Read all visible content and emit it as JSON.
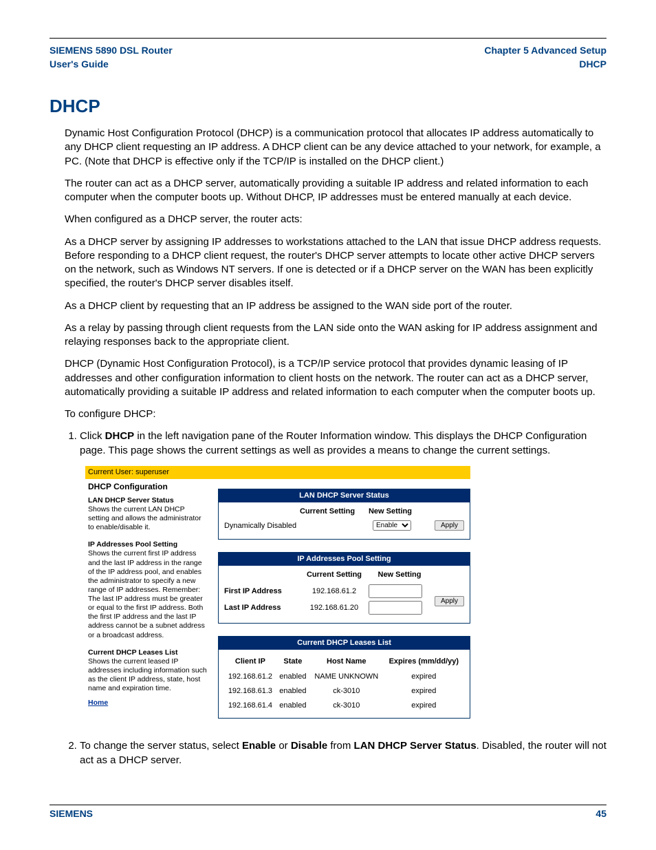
{
  "header": {
    "left_line1": "SIEMENS 5890 DSL Router",
    "left_line2": "User's Guide",
    "right_line1": "Chapter 5  Advanced Setup",
    "right_line2": "DHCP"
  },
  "title": "DHCP",
  "paragraphs": {
    "p1": "Dynamic Host Configuration Protocol (DHCP) is a communication protocol that allocates IP address automatically to any DHCP client requesting an IP address. A DHCP client can be any device attached to your network, for example, a PC. (Note that DHCP is effective only if the TCP/IP is installed on the DHCP client.)",
    "p2": "The router can act as a DHCP server, automatically providing a suitable IP address and related information to each computer when the computer boots up. Without DHCP, IP addresses must be entered manually at each device.",
    "p3": "When configured as a DHCP server, the router acts:",
    "p4": "As a DHCP server by assigning IP addresses to workstations attached to the LAN that issue DHCP address requests. Before responding to a DHCP client request, the router's DHCP server attempts to locate other active DHCP servers on the network, such as Windows NT servers. If one is detected or if a DHCP server on the WAN has been explicitly specified, the router's DHCP server disables itself.",
    "p5": "As a DHCP client by requesting that an IP address be assigned to the WAN side port of the router.",
    "p6": "As a relay by passing through client requests from the LAN side onto the WAN asking for IP address assignment and relaying responses back to the appropriate client.",
    "p7": "DHCP (Dynamic Host Configuration Protocol), is a TCP/IP service protocol that provides dynamic leasing of IP addresses and other configuration information to client hosts on the network. The router can act as a DHCP server, automatically providing a suitable IP address and related information to each computer when the computer boots up.",
    "p8": "To configure DHCP:"
  },
  "steps": {
    "s1_pre": "Click ",
    "s1_b": "DHCP",
    "s1_post": " in the left navigation pane of the Router Information window. This displays the DHCP Configuration page. This page shows the current settings as well as provides a means to change the current settings.",
    "s2_pre": "To change the server status, select ",
    "s2_b1": "Enable",
    "s2_mid1": " or ",
    "s2_b2": "Disable",
    "s2_mid2": " from ",
    "s2_b3": "LAN DHCP Server Status",
    "s2_post": ". Disabled, the router will not act as a DHCP server."
  },
  "ui": {
    "userbar": "Current User: superuser",
    "left": {
      "title": "DHCP Configuration",
      "sec1_h": "LAN DHCP Server Status",
      "sec1_t": "Shows the current LAN DHCP setting and allows the administrator to enable/disable it.",
      "sec2_h": "IP Addresses Pool Setting",
      "sec2_t": "Shows the current first IP address and the last IP address in the range of the IP address pool, and enables the administrator to specify a new range of IP addresses. Remember: The last IP address must be greater or equal to the first IP address. Both the first IP address and the last IP address cannot be a subnet address or a broadcast address.",
      "sec3_h": "Current DHCP Leases List",
      "sec3_t": "Shows the current leased IP addresses including information such as the client IP address, state, host name and expiration time.",
      "home": "Home"
    },
    "panel1": {
      "title": "LAN DHCP Server Status",
      "col_current": "Current Setting",
      "col_new": "New Setting",
      "current_value": "Dynamically Disabled",
      "select_value": "Enable",
      "apply": "Apply"
    },
    "panel2": {
      "title": "IP Addresses Pool Setting",
      "col_current": "Current Setting",
      "col_new": "New Setting",
      "row1_label": "First IP Address",
      "row1_val": "192.168.61.2",
      "row2_label": "Last IP Address",
      "row2_val": "192.168.61.20",
      "apply": "Apply"
    },
    "panel3": {
      "title": "Current DHCP Leases List",
      "headers": {
        "c1": "Client IP",
        "c2": "State",
        "c3": "Host Name",
        "c4": "Expires (mm/dd/yy)"
      },
      "rows": [
        {
          "ip": "192.168.61.2",
          "state": "enabled",
          "host": "NAME UNKNOWN",
          "exp": "expired"
        },
        {
          "ip": "192.168.61.3",
          "state": "enabled",
          "host": "ck-3010",
          "exp": "expired"
        },
        {
          "ip": "192.168.61.4",
          "state": "enabled",
          "host": "ck-3010",
          "exp": "expired"
        }
      ]
    }
  },
  "footer": {
    "left": "SIEMENS",
    "right": "45"
  }
}
